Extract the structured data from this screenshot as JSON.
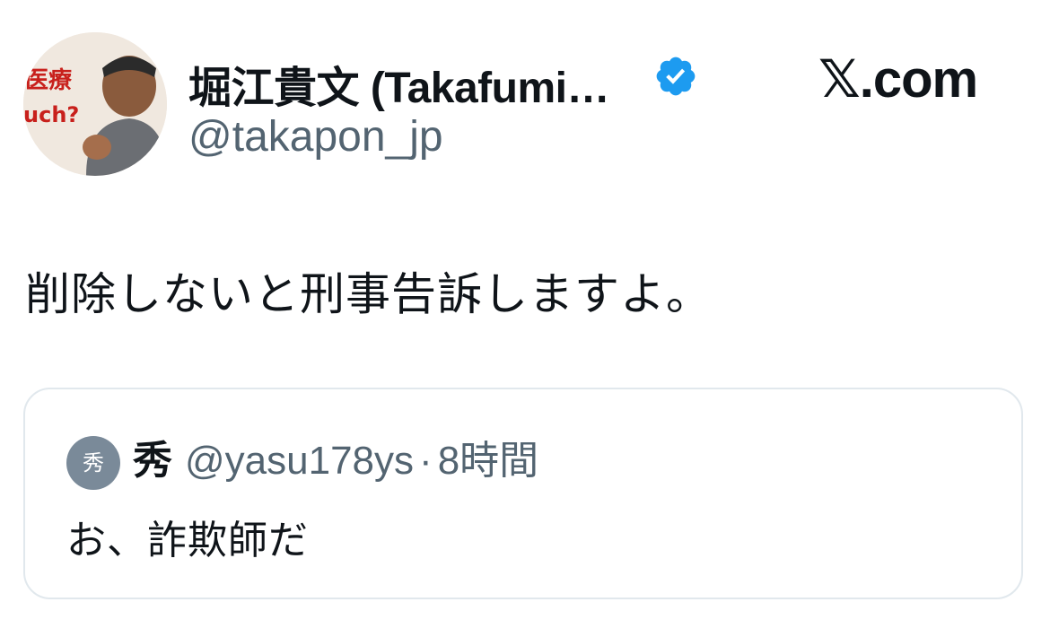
{
  "author": {
    "display_name": "堀江貴文 (Takafumi…",
    "handle": "@takapon_jp",
    "verified": true,
    "avatar": "profile-photo"
  },
  "site": {
    "label": "𝕏.com"
  },
  "tweet": {
    "text": "削除しないと刑事告訴しますよ。"
  },
  "quoted_tweet": {
    "avatar_text": "秀",
    "display_name": "秀",
    "handle": "@yasu178ys",
    "separator": "·",
    "time": "8時間",
    "text": "お、詐欺師だ"
  },
  "colors": {
    "verified_badge": "#1d9bf0",
    "secondary_text": "#536471",
    "border": "#e1e8ed"
  }
}
